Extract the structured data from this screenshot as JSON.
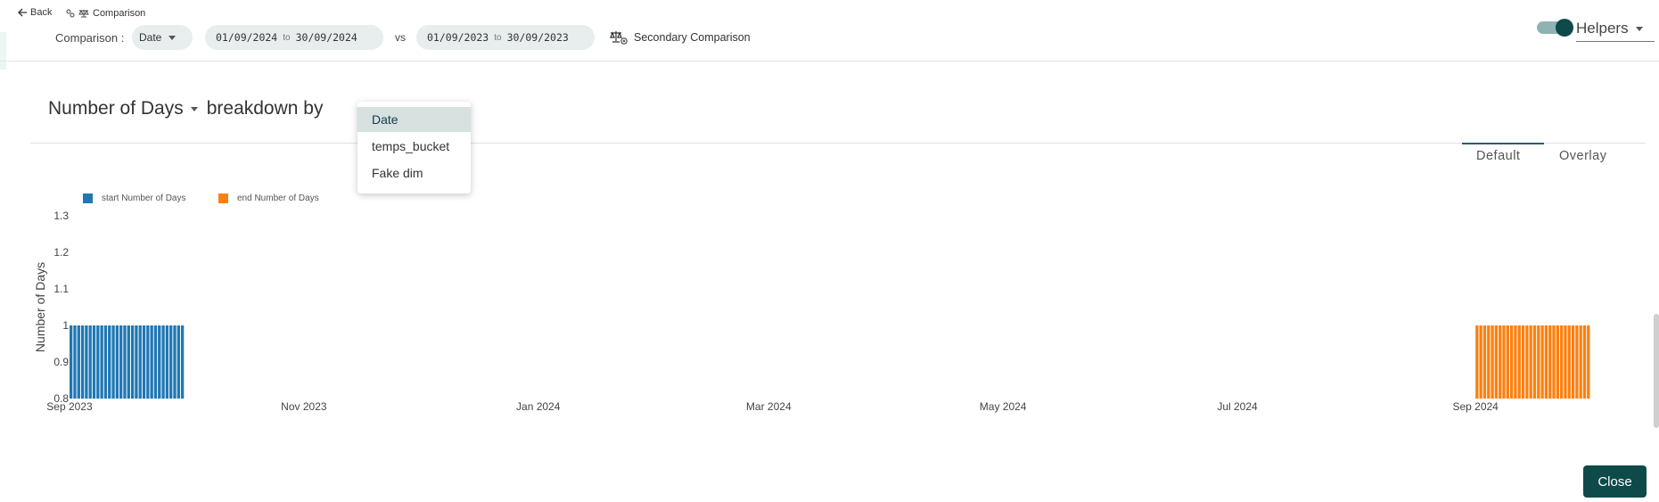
{
  "nav": {
    "back_label": "Back",
    "crumb_label": "Comparison"
  },
  "comparison": {
    "label": "Comparison :",
    "type_value": "Date",
    "range1": {
      "from": "01/09/2024",
      "to_word": "to",
      "to": "30/09/2024"
    },
    "vs_label": "vs",
    "range2": {
      "from": "01/09/2023",
      "to_word": "to",
      "to": "30/09/2023"
    },
    "secondary_label": "Secondary Comparison"
  },
  "helpers": {
    "label": "Helpers",
    "toggle_on": true
  },
  "chart_header": {
    "metric": "Number of Days",
    "breakdown_text": "breakdown by"
  },
  "breakdown_dropdown": {
    "options": [
      "Date",
      "temps_bucket",
      "Fake dim"
    ],
    "selected_index": 0
  },
  "view_tabs": {
    "default_label": "Default",
    "overlay_label": "Overlay",
    "active": "Default"
  },
  "colors": {
    "accent": "#0e4a4a",
    "start_series": "#1f77b4",
    "end_series": "#ff7f0e"
  },
  "chart_data": {
    "type": "bar",
    "ylabel": "Number of Days",
    "xlabel": "",
    "ylim": [
      0.8,
      1.3
    ],
    "y_ticks": [
      "1.3",
      "1.2",
      "1.1",
      "1",
      "0.9",
      "0.8"
    ],
    "x_range": [
      "2023-09-01",
      "2024-10-06"
    ],
    "x_ticks": [
      {
        "date": "2023-09-01",
        "label": "Sep 2023"
      },
      {
        "date": "2023-11-01",
        "label": "Nov 2023"
      },
      {
        "date": "2024-01-01",
        "label": "Jan 2024"
      },
      {
        "date": "2024-03-01",
        "label": "Mar 2024"
      },
      {
        "date": "2024-05-01",
        "label": "May 2024"
      },
      {
        "date": "2024-07-01",
        "label": "Jul 2024"
      },
      {
        "date": "2024-09-01",
        "label": "Sep 2024"
      }
    ],
    "series": [
      {
        "name": "start Number of Days",
        "color": "#1f77b4",
        "from": "2023-09-01",
        "to": "2023-09-30",
        "value": 1
      },
      {
        "name": "end Number of Days",
        "color": "#ff7f0e",
        "from": "2024-09-01",
        "to": "2024-09-30",
        "value": 1
      }
    ],
    "legend_position": "top-left",
    "grid": false
  }
}
